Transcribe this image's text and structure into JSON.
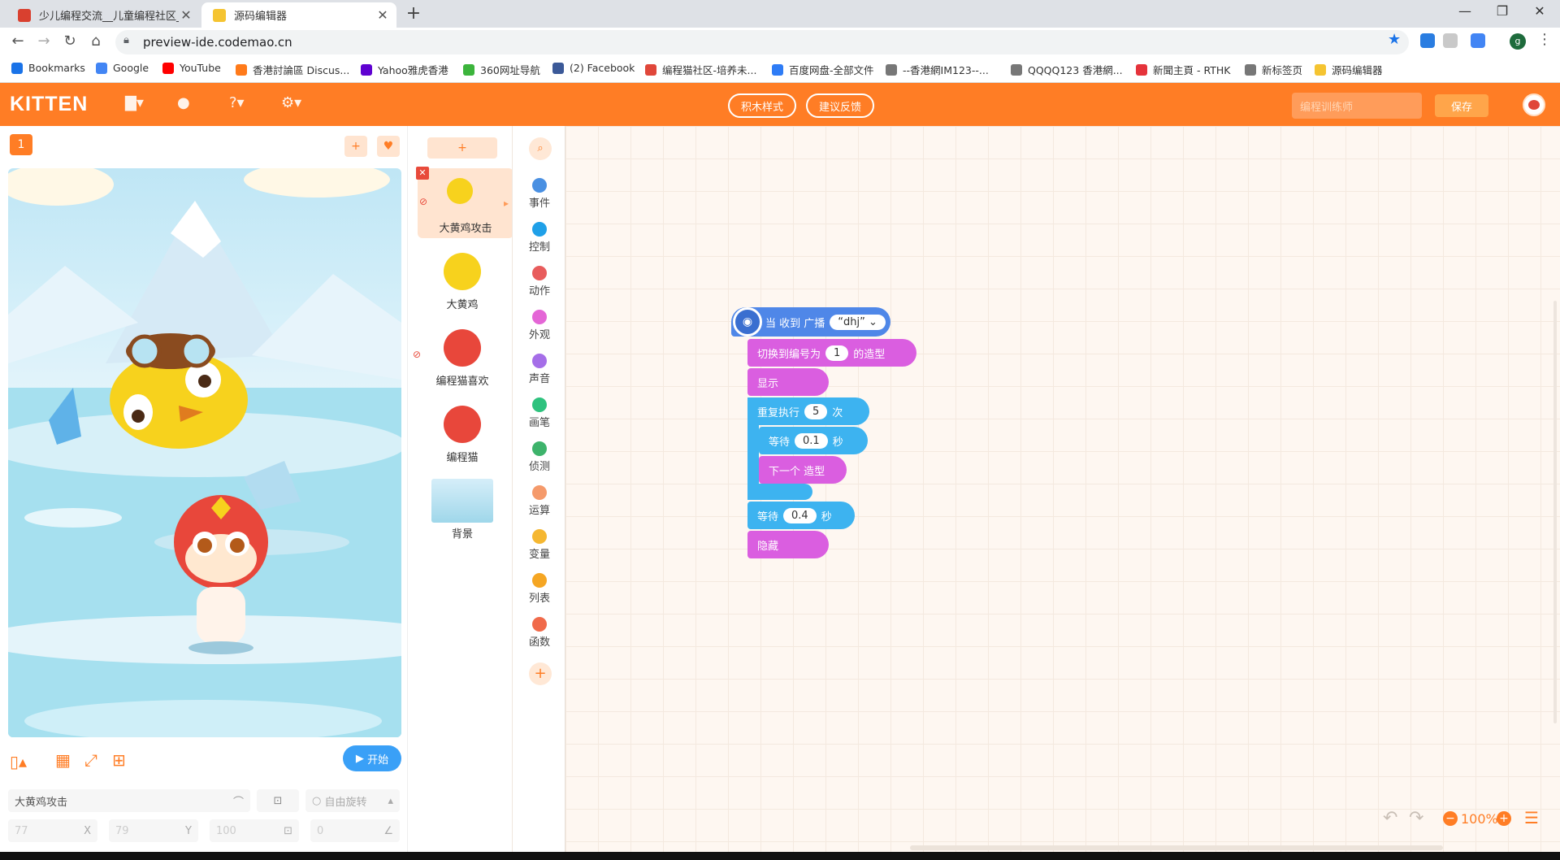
{
  "browser": {
    "tabs": [
      {
        "title": "少儿编程交流__儿童编程社区_sc",
        "color": "#d9402f",
        "active": false
      },
      {
        "title": "源码编辑器",
        "color": "#f5c431",
        "active": true
      }
    ],
    "url": "preview-ide.codemao.cn",
    "profile_initial": "g",
    "bookmarks": [
      {
        "label": "Bookmarks",
        "color": "#1a73e8"
      },
      {
        "label": "Google",
        "color": "#4285f4"
      },
      {
        "label": "YouTube",
        "color": "#ff0000"
      },
      {
        "label": "香港討論區 Discus...",
        "color": "#ff7a1a"
      },
      {
        "label": "Yahoo雅虎香港",
        "color": "#5f01d1"
      },
      {
        "label": "360网址导航",
        "color": "#3cb43c"
      },
      {
        "label": "(2) Facebook",
        "color": "#3b5998"
      },
      {
        "label": "编程猫社区-培养未...",
        "color": "#e0473a"
      },
      {
        "label": "百度网盘-全部文件",
        "color": "#2e7cf6"
      },
      {
        "label": "--香港網IM123--...",
        "color": "#777777"
      },
      {
        "label": "QQQQ123 香港網...",
        "color": "#777777"
      },
      {
        "label": "新聞主頁 - RTHK",
        "color": "#e5333b"
      },
      {
        "label": "新标签页",
        "color": "#777777"
      },
      {
        "label": "源码编辑器",
        "color": "#f5c431"
      }
    ]
  },
  "app": {
    "logo": "KITTEN",
    "block_style_btn": "积木样式",
    "feedback_btn": "建议反馈",
    "search_placeholder": "编程训练师",
    "save_btn": "保存",
    "accent": "#ff7d25"
  },
  "stage": {
    "scene_number": "1",
    "start_btn": "开始",
    "sprite_name": "大黄鸡攻击",
    "rotate_label": "自由旋转",
    "x": "77",
    "x_label": "X",
    "y": "79",
    "y_label": "Y",
    "size": "100",
    "rotation": "0"
  },
  "sprites": [
    {
      "name": "大黄鸡攻击",
      "selected": true
    },
    {
      "name": "大黄鸡",
      "selected": false
    },
    {
      "name": "编程猫喜欢",
      "selected": false
    },
    {
      "name": "编程猫",
      "selected": false
    },
    {
      "name": "背景",
      "selected": false
    }
  ],
  "categories": [
    {
      "label": "事件",
      "color": "#4a90e2"
    },
    {
      "label": "控制",
      "color": "#1fa0e8"
    },
    {
      "label": "动作",
      "color": "#e85c5c"
    },
    {
      "label": "外观",
      "color": "#e466d6"
    },
    {
      "label": "声音",
      "color": "#a56ee8"
    },
    {
      "label": "画笔",
      "color": "#2ec27e"
    },
    {
      "label": "侦测",
      "color": "#3db36b"
    },
    {
      "label": "运算",
      "color": "#f59a6b"
    },
    {
      "label": "变量",
      "color": "#f5b731"
    },
    {
      "label": "列表",
      "color": "#f5a623"
    },
    {
      "label": "函数",
      "color": "#f06a4a"
    }
  ],
  "blocks": {
    "hat": {
      "text": "当 收到 广播",
      "value": "“dhj”"
    },
    "costume": {
      "pre": "切换到编号为",
      "value": "1",
      "post": "的造型"
    },
    "show": "显示",
    "repeat": {
      "pre": "重复执行",
      "value": "5",
      "post": "次"
    },
    "wait_inner": {
      "pre": "等待",
      "value": "0.1",
      "post": "秒"
    },
    "next_costume": "下一个 造型",
    "wait_outer": {
      "pre": "等待",
      "value": "0.4",
      "post": "秒"
    },
    "hide": "隐藏"
  },
  "workspace": {
    "zoom": "100%"
  }
}
